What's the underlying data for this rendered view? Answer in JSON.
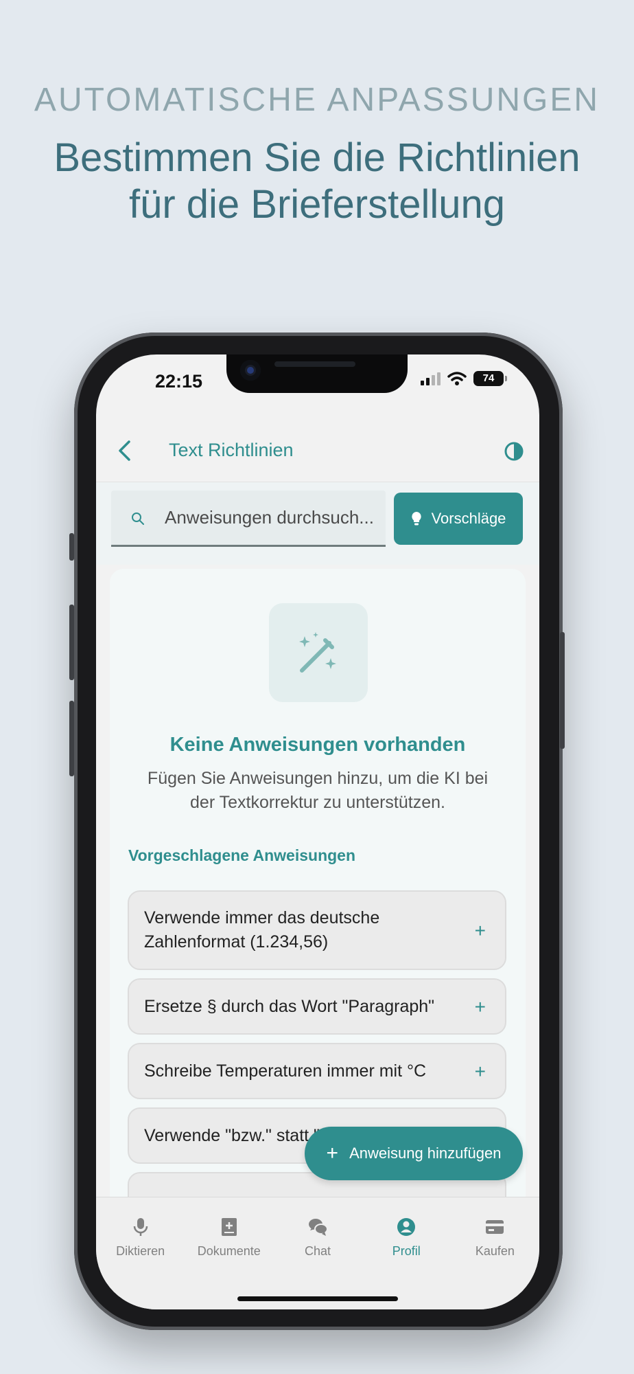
{
  "promo": {
    "kicker": "AUTOMATISCHE ANPASSUNGEN",
    "title_line1": "Bestimmen Sie die Richtlinien",
    "title_line2": "für die Brieferstellung"
  },
  "status_bar": {
    "time": "22:15",
    "battery": "74"
  },
  "header": {
    "title": "Text Richtlinien",
    "back_icon": "chevron-left-icon",
    "theme_icon": "contrast-icon"
  },
  "search": {
    "placeholder": "Anweisungen durchsuch...",
    "value": ""
  },
  "suggest_button": {
    "label": "Vorschläge",
    "icon": "lightbulb-icon"
  },
  "empty_state": {
    "icon": "magic-wand-icon",
    "title": "Keine Anweisungen vorhanden",
    "description": "Fügen Sie Anweisungen hinzu, um die KI bei der Textkorrektur zu unterstützen."
  },
  "suggested": {
    "heading": "Vorgeschlagene Anweisungen",
    "items": [
      {
        "text": "Verwende immer das deutsche Zahlenformat (1.234,56)",
        "action": "+"
      },
      {
        "text": "Ersetze § durch das Wort \"Paragraph\"",
        "action": "+"
      },
      {
        "text": "Schreibe Temperaturen immer mit °C",
        "action": "+"
      },
      {
        "text": "Verwende \"bzw.\" statt \"",
        "action": "+"
      }
    ]
  },
  "fab": {
    "label": "Anweisung hinzufügen",
    "icon": "+"
  },
  "bottom_nav": {
    "items": [
      {
        "label": "Diktieren",
        "icon": "microphone-icon",
        "active": false
      },
      {
        "label": "Dokumente",
        "icon": "book-add-icon",
        "active": false
      },
      {
        "label": "Chat",
        "icon": "chat-bubbles-icon",
        "active": false
      },
      {
        "label": "Profil",
        "icon": "user-circle-icon",
        "active": true
      },
      {
        "label": "Kaufen",
        "icon": "credit-card-icon",
        "active": false
      }
    ]
  },
  "colors": {
    "accent": "#2f8e8e",
    "promo_title": "#3d6e7c",
    "promo_kicker": "#8fa6ad",
    "background": "#e3e9ef"
  }
}
